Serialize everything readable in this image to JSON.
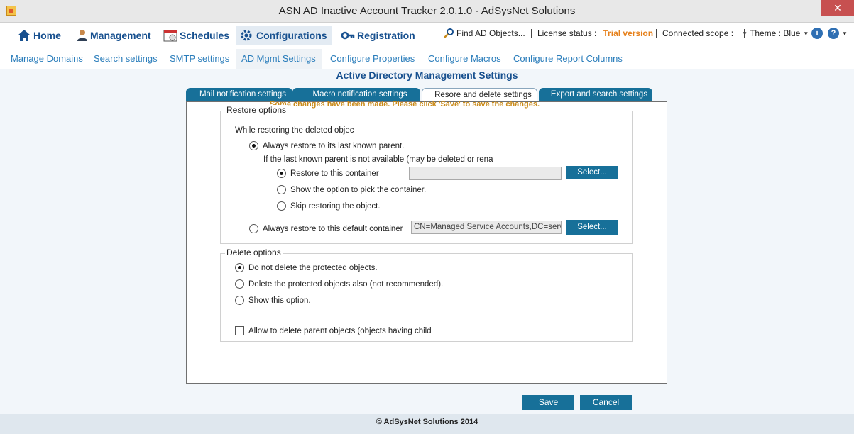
{
  "window": {
    "title": "ASN AD Inactive Account Tracker 2.0.1.0 - AdSysNet Solutions",
    "close": "✕"
  },
  "nav": {
    "home": "Home",
    "management": "Management",
    "schedules": "Schedules",
    "configurations": "Configurations",
    "registration": "Registration",
    "find_ad_objects": "Find AD Objects...",
    "license_label": "License status :",
    "license_value": "Trial version",
    "connected_scope": "Connected scope :",
    "theme": "Theme : Blue",
    "info_icon": "i",
    "help_icon": "?"
  },
  "subnav": [
    "Manage Domains",
    "Search settings",
    "SMTP settings",
    "AD Mgmt Settings",
    "Configure Properties",
    "Configure Macros",
    "Configure Report Columns"
  ],
  "page": {
    "title": "Active Directory Management Settings",
    "warning": "Some changes have been made. Please click 'Save' to save the changes."
  },
  "tabs": [
    "Mail notification settings",
    "Macro  notification settings",
    "Resore and delete settings",
    "Export and search settings"
  ],
  "restore": {
    "legend": "Restore options",
    "intro": "While restoring the deleted objec",
    "opt_last_parent": "Always restore to its last known parent.",
    "unavailable_note": "If the last known parent is not available (may be deleted or rena",
    "opt_restore_container": "Restore to this container",
    "container_value": "",
    "select1": "Select...",
    "opt_show_pick": "Show the option to pick the container.",
    "opt_skip": "Skip restoring the object.",
    "opt_default_container": "Always restore to this default container",
    "default_container_value": "CN=Managed Service Accounts,DC=serv",
    "select2": "Select..."
  },
  "delete": {
    "legend": "Delete options",
    "opt_no_delete": "Do not delete the protected objects.",
    "opt_delete_also": "Delete the protected objects also (not recommended).",
    "opt_show": "Show this option.",
    "chk_parent": "Allow to delete parent objects (objects having child"
  },
  "buttons": {
    "save": "Save",
    "cancel": "Cancel"
  },
  "footer": "© AdSysNet Solutions 2014",
  "colors": {
    "accent": "#177099",
    "nav_text": "#17508f",
    "link": "#2a7dbb",
    "trial": "#e6801a",
    "warning": "#c98a1a"
  }
}
